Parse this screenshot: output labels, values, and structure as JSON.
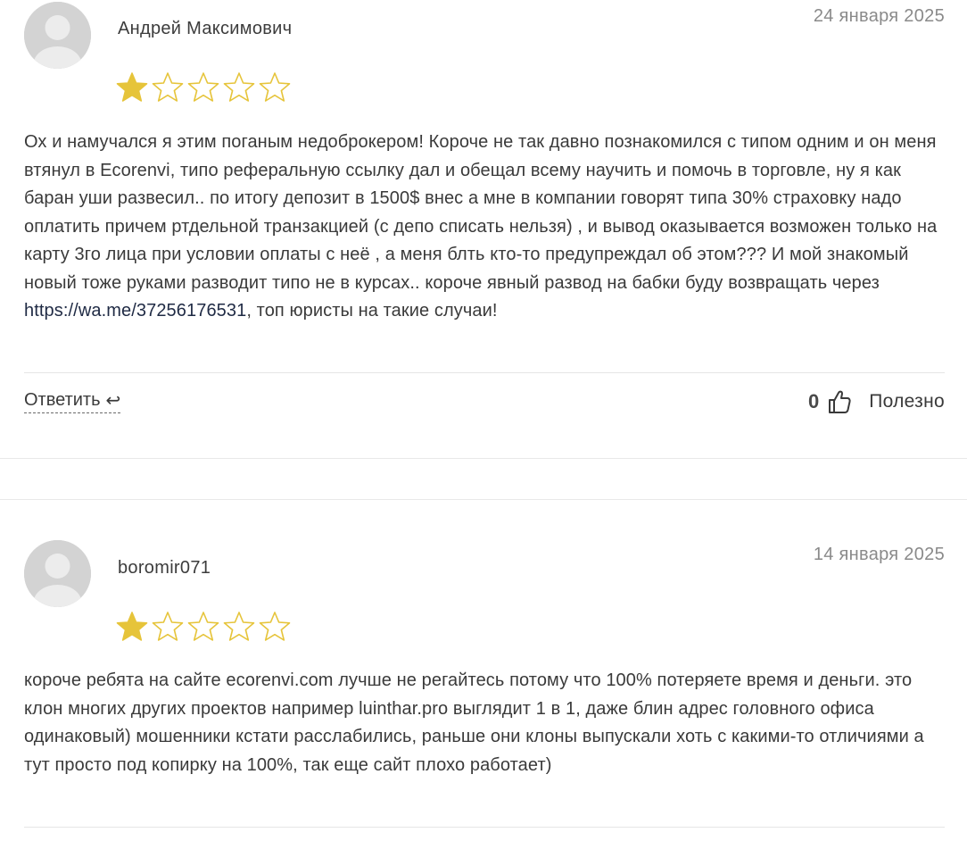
{
  "reviews": [
    {
      "author": "Андрей Максимович",
      "date": "24 января 2025",
      "rating": 1,
      "rating_max": 5,
      "text_before_link": "Ох и намучался я этим поганым недоброкером! Короче не так давно познакомился с типом одним и он меня втянул в Ecorenvi, типо реферальную ссылку дал и обещал всему научить и помочь в торговле, ну я как баран уши развесил.. по итогу депозит в 1500$ внес а мне в компании говорят типа 30% страховку надо оплатить причем ртдельной транзакцией (с депо списать нельзя) , и вывод оказывается возможен только на карту 3го лица при условии оплаты с неё , а меня блть кто-то предупреждал об этом??? И мой знакомый новый тоже руками разводит типо не в курсах.. короче явный развод на бабки буду возвращать через ",
      "link": "https://wa.me/37256176531",
      "text_after_link": ", топ юристы на такие случаи!",
      "reply_label": "Ответить",
      "helpful_count": "0",
      "helpful_label": "Полезно"
    },
    {
      "author": "boromir071",
      "date": "14 января 2025",
      "rating": 1,
      "rating_max": 5,
      "text": "короче ребята на сайте ecorenvi.com лучше не регайтесь потому что 100% потеряете время и деньги. это клон многих других проектов например luinthar.pro выглядит 1 в 1, даже блин адрес головного офиса одинаковый) мошенники кстати расслабились, раньше они клоны выпускали хоть с какими-то отличиями а тут просто под копирку на 100%, так еще сайт плохо работает)"
    }
  ],
  "icons": {
    "avatar": "user-avatar-placeholder",
    "star": "star-icon",
    "reply": "reply-arrow-icon",
    "helpful": "thumbs-up-icon"
  },
  "colors": {
    "star_filled": "#e6c43a",
    "star_outline": "#e6c43a",
    "avatar_bg": "#d3d3d3",
    "link": "#1f2a44",
    "date": "#8a8a8a"
  }
}
